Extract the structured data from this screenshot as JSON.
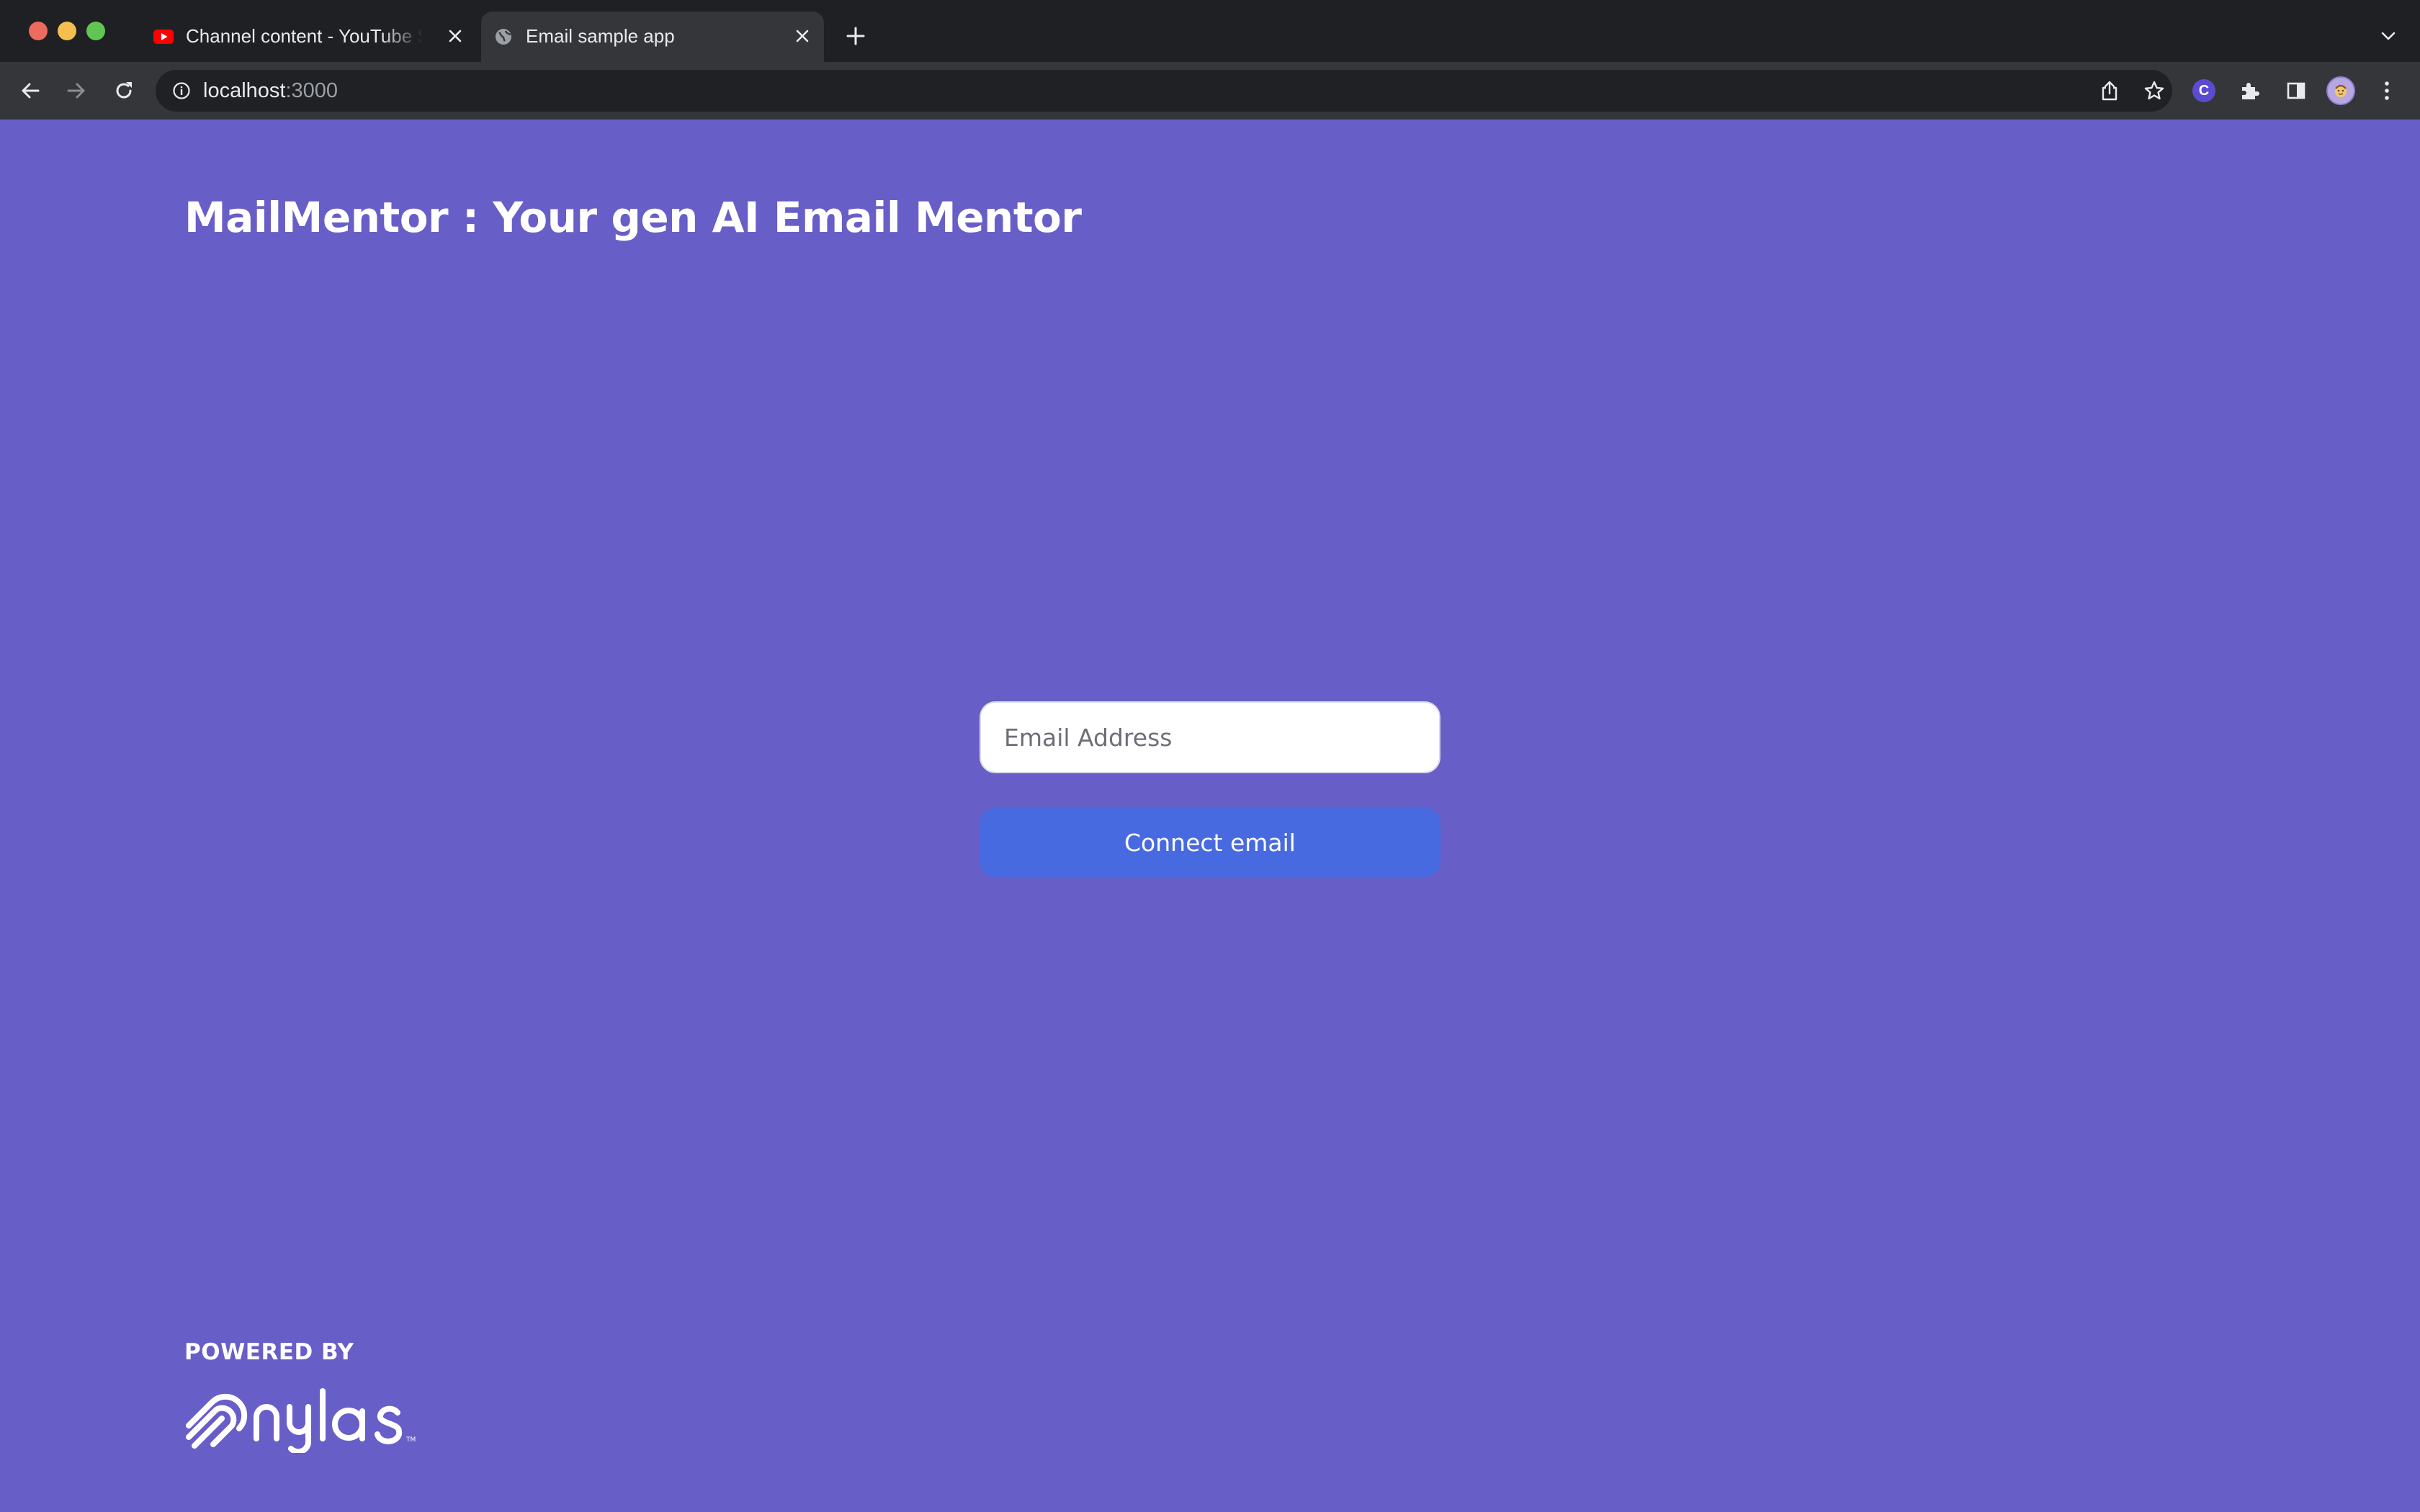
{
  "browser": {
    "tabs": [
      {
        "title": "Channel content - YouTube Studio",
        "favicon": "youtube-icon",
        "active": false
      },
      {
        "title": "Email sample app",
        "favicon": "globe-icon",
        "active": true
      }
    ],
    "address_bar": {
      "host": "localhost",
      "port": ":3000"
    }
  },
  "page": {
    "title": "MailMentor : Your gen AI Email Mentor",
    "email_input": {
      "placeholder": "Email Address",
      "value": ""
    },
    "connect_button_label": "Connect email",
    "footer": {
      "powered_by": "POWERED BY",
      "brand_logo": "nylas"
    }
  },
  "colors": {
    "page_background": "#685ec7",
    "button_background": "#486ae0",
    "chrome_dark": "#1f2023",
    "toolbar": "#35363a"
  }
}
